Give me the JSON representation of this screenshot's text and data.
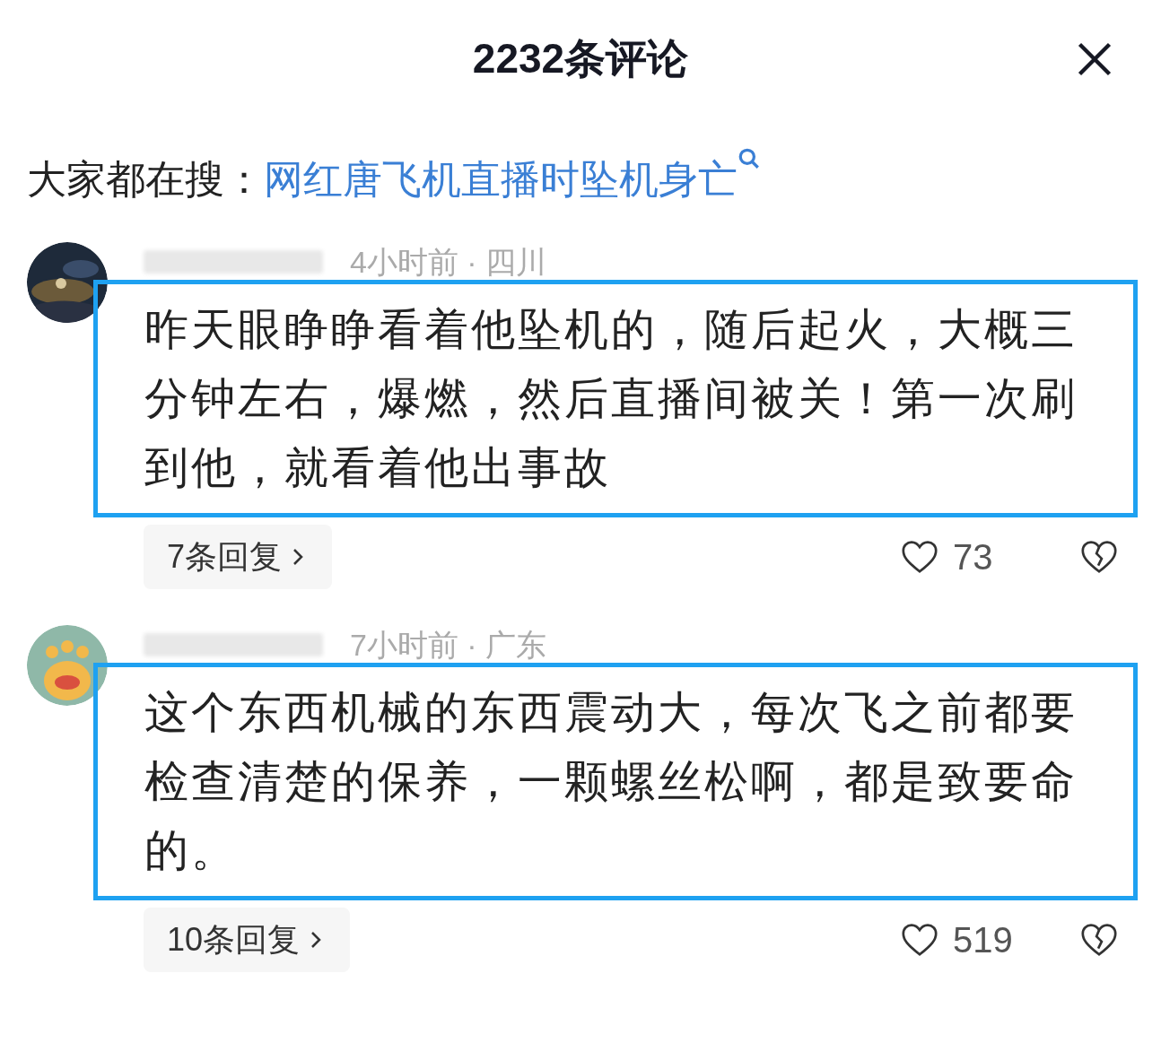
{
  "header": {
    "title": "2232条评论"
  },
  "search_suggestion": {
    "label": "大家都在搜：",
    "query": "网红唐飞机直播时坠机身亡"
  },
  "comments": [
    {
      "meta": "4小时前 · 四川",
      "text": "昨天眼睁睁看着他坠机的，随后起火，大概三分钟左右，爆燃，然后直播间被关！第一次刷到他，就看着他出事故",
      "highlighted": true,
      "replies": "7条回复",
      "likes": "73"
    },
    {
      "meta": "7小时前 · 广东",
      "text": "这个东西机械的东西震动大，每次飞之前都要检查清楚的保养，一颗螺丝松啊，都是致要命的。",
      "highlighted": true,
      "replies": "10条回复",
      "likes": "519"
    }
  ]
}
